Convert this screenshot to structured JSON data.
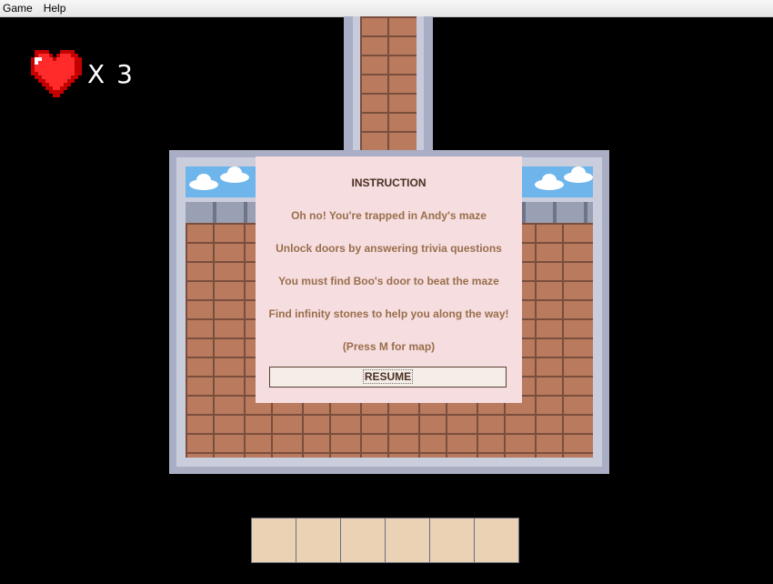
{
  "menubar": {
    "items": [
      "Game",
      "Help"
    ]
  },
  "lives": {
    "icon": "heart-icon",
    "count_text": "X 3"
  },
  "dialog": {
    "title": "INSTRUCTION",
    "lines": [
      "Oh no! You're trapped in Andy's maze",
      "Unlock doors by answering trivia questions",
      "You must find Boo's door to beat the maze",
      "Find infinity stones to help you along the way!",
      "(Press M for map)"
    ],
    "resume_label": "RESUME"
  },
  "inventory": {
    "slot_count": 6
  },
  "colors": {
    "background": "#000000",
    "dialog_bg": "#f5dde0",
    "dialog_text": "#9a6e4a",
    "brick": "#b97a5e",
    "wall": "#a9aec4",
    "sky": "#6eb5ec",
    "slot": "#ecd2b5"
  }
}
